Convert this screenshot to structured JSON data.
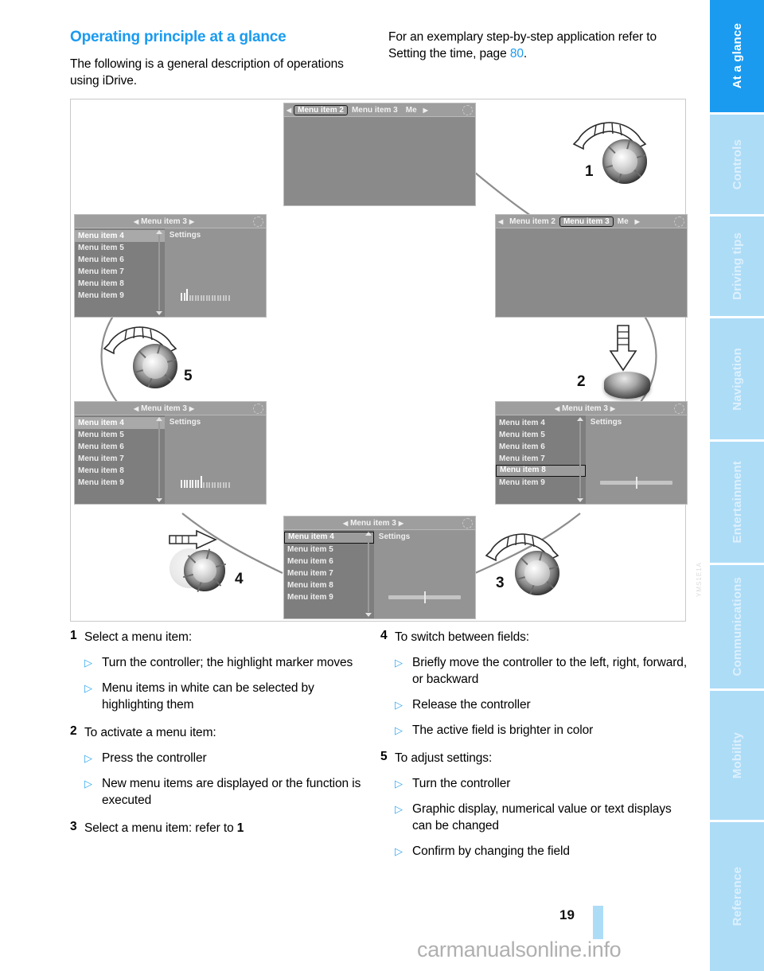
{
  "document": {
    "page_number": "19",
    "watermark": "carmanualsonline.info",
    "figure_code": "YMS1E1A"
  },
  "header": {
    "section_title": "Operating principle at a glance",
    "intro": "The following is a general description of operations using iDrive.",
    "cross_ref_before": "For an exemplary step-by-step application refer to Setting the time, page ",
    "cross_ref_page": "80",
    "cross_ref_after": "."
  },
  "sidebar": {
    "tabs": [
      {
        "label": "At a glance",
        "active": true
      },
      {
        "label": "Controls",
        "active": false
      },
      {
        "label": "Driving tips",
        "active": false
      },
      {
        "label": "Navigation",
        "active": false
      },
      {
        "label": "Entertainment",
        "active": false
      },
      {
        "label": "Communications",
        "active": false
      },
      {
        "label": "Mobility",
        "active": false
      },
      {
        "label": "Reference",
        "active": false
      }
    ],
    "colors": {
      "active_bg": "#1a9bf0",
      "inactive_bg": "#addcf7",
      "label": "#ffffff"
    }
  },
  "figure": {
    "screens": {
      "top": {
        "name": "screen-top",
        "tabs": [
          "Menu item 2",
          "Menu item 3",
          "Me"
        ],
        "selected_tab": "Menu item 2",
        "body": "empty"
      },
      "right_upper": {
        "name": "screen-right-upper",
        "tabs": [
          "Menu item 2",
          "Menu item 3",
          "Me"
        ],
        "selected_tab": "Menu item 3",
        "body": "empty"
      },
      "right_lower": {
        "name": "screen-right-lower",
        "title": "Menu item 3",
        "list": [
          "Menu item 4",
          "Menu item 5",
          "Menu item 6",
          "Menu item 7",
          "Menu item 8",
          "Menu item 9"
        ],
        "boxed_item": "Menu item 8",
        "pane_label": "Settings",
        "control": "slider"
      },
      "bottom_center": {
        "name": "screen-bottom-center",
        "title": "Menu item 3",
        "list": [
          "Menu item 4",
          "Menu item 5",
          "Menu item 6",
          "Menu item 7",
          "Menu item 8",
          "Menu item 9"
        ],
        "boxed_item": "Menu item 4",
        "pane_label": "Settings",
        "control": "slider"
      },
      "left_lower": {
        "name": "screen-left-lower",
        "title": "Menu item 3",
        "list": [
          "Menu item 4",
          "Menu item 5",
          "Menu item 6",
          "Menu item 7",
          "Menu item 8",
          "Menu item 9"
        ],
        "highlighted_item": "Menu item 4",
        "pane_label": "Settings",
        "control": "bargraph",
        "bargraph_filled": 7
      },
      "left_upper": {
        "name": "screen-left-upper",
        "title": "Menu item 3",
        "list": [
          "Menu item 4",
          "Menu item 5",
          "Menu item 6",
          "Menu item 7",
          "Menu item 8",
          "Menu item 9"
        ],
        "highlighted_item": "Menu item 4",
        "pane_label": "Settings",
        "control": "bargraph",
        "bargraph_filled": 2
      }
    },
    "controllers": [
      {
        "number": "1",
        "action": "turn",
        "name": "controller-step-1"
      },
      {
        "number": "2",
        "action": "press",
        "name": "controller-step-2"
      },
      {
        "number": "3",
        "action": "turn",
        "name": "controller-step-3"
      },
      {
        "number": "4",
        "action": "move",
        "name": "controller-step-4"
      },
      {
        "number": "5",
        "action": "turn",
        "name": "controller-step-5"
      }
    ]
  },
  "instructions": {
    "left": [
      {
        "number": "1",
        "title": "Select a menu item:",
        "bullets": [
          "Turn the controller; the highlight marker moves",
          "Menu items in white can be selected by highlighting them"
        ]
      },
      {
        "number": "2",
        "title": "To activate a menu item:",
        "bullets": [
          "Press the controller",
          "New menu items are displayed or the function is executed"
        ]
      },
      {
        "number": "3",
        "title": "Select a menu item: refer to 1",
        "bullets": []
      }
    ],
    "right": [
      {
        "number": "4",
        "title": "To switch between fields:",
        "bullets": [
          "Briefly move the controller to the left, right, forward, or backward",
          "Release the controller",
          "The active field is brighter in color"
        ]
      },
      {
        "number": "5",
        "title": "To adjust settings:",
        "bullets": [
          "Turn the controller",
          "Graphic display, numerical value or text displays can be changed",
          "Confirm by changing the field"
        ]
      }
    ]
  }
}
